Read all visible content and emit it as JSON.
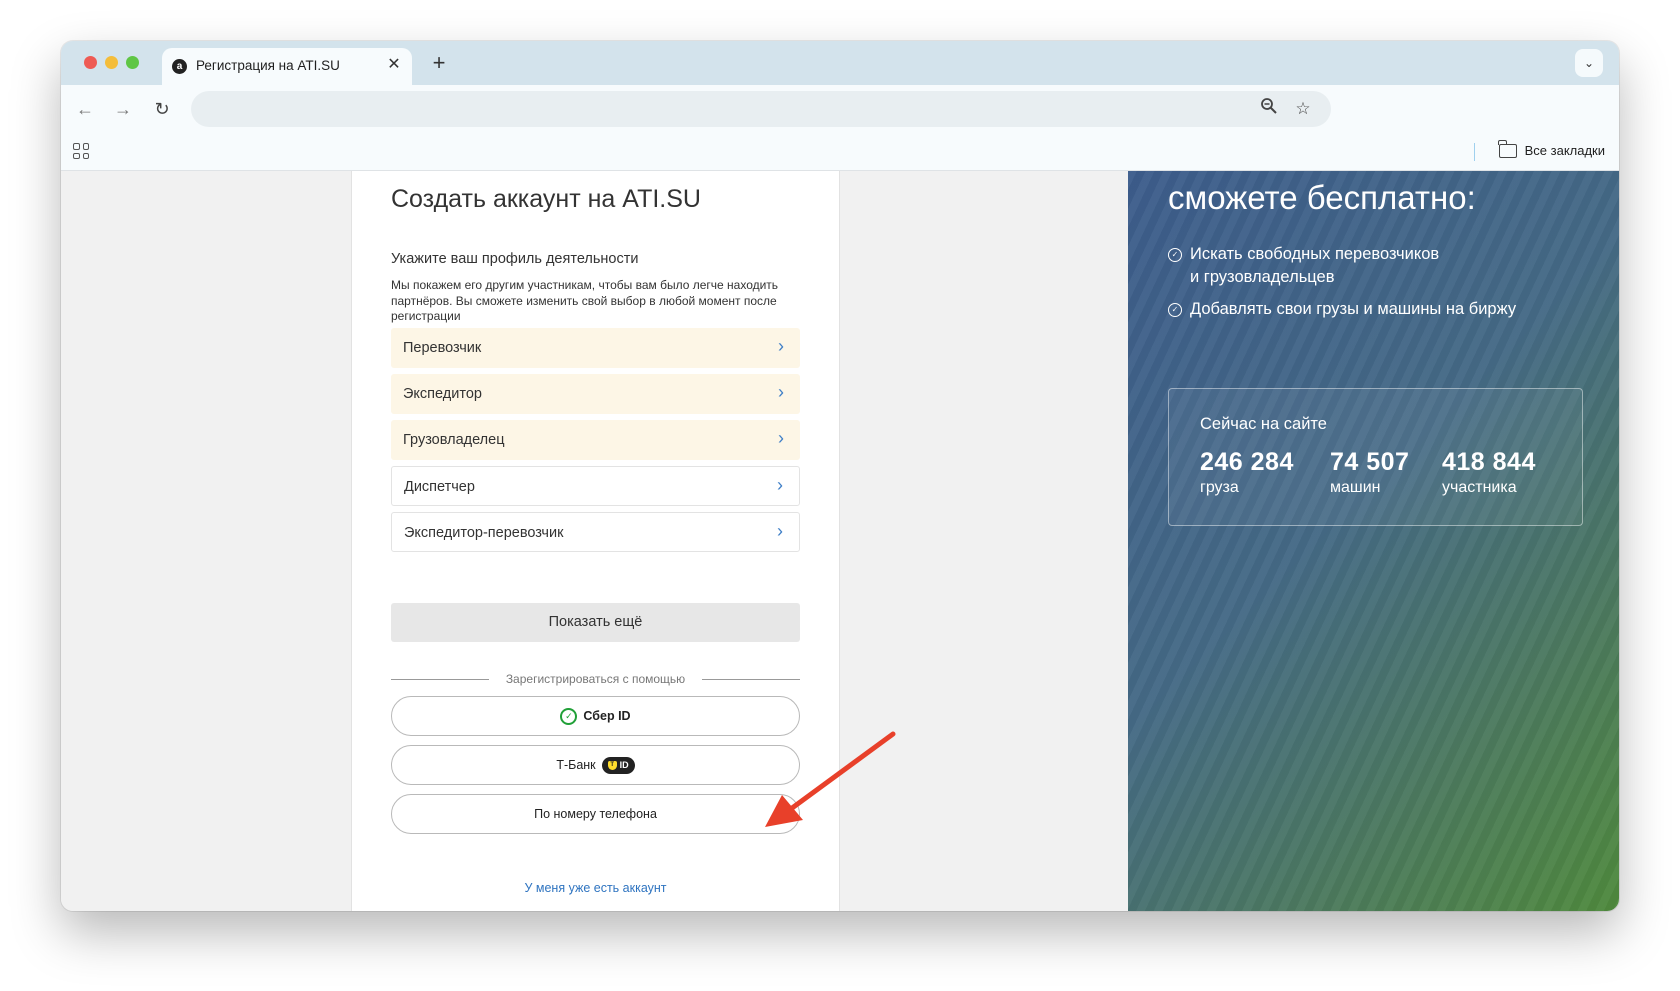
{
  "browser": {
    "tab_title": "Регистрация на ATI.SU",
    "tab_favicon": "ati-logo-icon",
    "address": "",
    "bookmarks_all": "Все закладки",
    "icons": {
      "back": "arrow-left-icon",
      "forward": "arrow-right-icon",
      "reload": "reload-icon",
      "zoom": "zoom-icon",
      "star": "star-icon",
      "apps": "apps-grid-icon",
      "folder": "folder-icon"
    }
  },
  "form": {
    "title": "Создать аккаунт на ATI.SU",
    "subtitle": "Укажите ваш профиль деятельности",
    "hint": "Мы покажем его другим участникам, чтобы вам было легче находить партнёров. Вы сможете изменить свой выбор в любой момент после регистрации",
    "roles": [
      {
        "label": "Перевозчик",
        "highlight": true
      },
      {
        "label": "Экспедитор",
        "highlight": true
      },
      {
        "label": "Грузовладелец",
        "highlight": true
      },
      {
        "label": "Диспетчер",
        "highlight": false
      },
      {
        "label": "Экспедитор-перевозчик",
        "highlight": false
      }
    ],
    "show_more": "Показать ещё",
    "divider_text": "Зарегистрироваться с помощью",
    "sber_label": "Сбер ID",
    "tbank_label": "Т-Банк",
    "tbank_badge": "ID",
    "phone_label": "По номеру телефона",
    "login_link": "У меня уже есть аккаунт"
  },
  "promo": {
    "heading": "сможете бесплатно:",
    "benefits": [
      "Искать свободных перевозчиков и грузовладельцев",
      "Добавлять свои грузы и машины на биржу"
    ],
    "stats_title": "Сейчас на сайте",
    "stats": [
      {
        "value": "246 284",
        "label": "груза"
      },
      {
        "value": "74 507",
        "label": "машин"
      },
      {
        "value": "418 844",
        "label": "участника"
      }
    ]
  },
  "colors": {
    "accent_link": "#2f74c0",
    "role_highlight": "#fdf6e6",
    "annotation_arrow": "#e8402a",
    "sber_green": "#21a038"
  }
}
